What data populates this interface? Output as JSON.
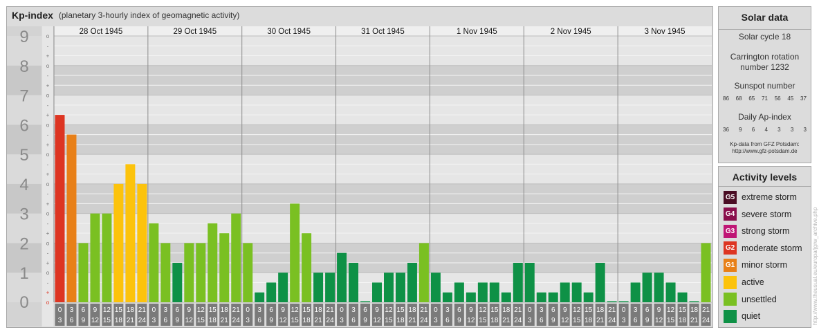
{
  "header": {
    "title": "Kp-index",
    "subtitle": "(planetary 3-hourly index of geomagnetic activity)"
  },
  "chart_data": {
    "type": "bar",
    "days": [
      "28 Oct 1945",
      "29 Oct 1945",
      "30 Oct 1945",
      "31 Oct 1945",
      "1 Nov 1945",
      "2 Nov 1945",
      "3 Nov 1945"
    ],
    "interval_start_hours": [
      "0",
      "3",
      "6",
      "9",
      "12",
      "15",
      "18",
      "21"
    ],
    "interval_end_hours": [
      "3",
      "6",
      "9",
      "12",
      "15",
      "18",
      "21",
      "24"
    ],
    "y_axis_labels": [
      "0",
      "1",
      "2",
      "3",
      "4",
      "5",
      "6",
      "7",
      "8",
      "9"
    ],
    "minor_tick_labels": [
      "o",
      "+",
      "-",
      "o",
      "+",
      "-",
      "o",
      "+",
      "-",
      "o",
      "+",
      "-",
      "o",
      "+",
      "-",
      "o",
      "+",
      "-",
      "o",
      "+",
      "-",
      "o",
      "+",
      "-",
      "o",
      "+",
      "-",
      "o"
    ],
    "ylim": [
      0,
      9
    ],
    "values": [
      6.333,
      5.667,
      2,
      3,
      3,
      4,
      4.667,
      4,
      2.667,
      2,
      1.333,
      2,
      2,
      2.667,
      2.333,
      3,
      2,
      0.333,
      0.667,
      1,
      3.333,
      2.333,
      1,
      1,
      1.667,
      1.333,
      0,
      0.667,
      1,
      1,
      1.333,
      2,
      1,
      0.333,
      0.667,
      0.333,
      0.667,
      0.667,
      0.333,
      1.333,
      1.333,
      0.333,
      0.333,
      0.667,
      0.667,
      0.333,
      1.333,
      0,
      0,
      0.667,
      1,
      1,
      0.667,
      0.333,
      0,
      2
    ]
  },
  "colors": {
    "quiet": "#0e9146",
    "unsettled": "#7ac022",
    "active": "#fcc30c",
    "minor_storm": "#e88018",
    "moderate_storm": "#dd3522",
    "strong_storm": "#bf1575",
    "severe_storm": "#8a0f4c",
    "extreme_storm": "#4a0d24"
  },
  "solar_data": {
    "title": "Solar data",
    "cycle": "Solar cycle 18",
    "carrington_line1": "Carrington rotation",
    "carrington_line2": "number 1232",
    "sunspot_label": "Sunspot number",
    "sunspot_values": [
      "86",
      "68",
      "65",
      "71",
      "56",
      "45",
      "37"
    ],
    "ap_label": "Daily Ap-index",
    "ap_values": [
      "36",
      "9",
      "6",
      "4",
      "3",
      "3",
      "3"
    ],
    "source_line1": "Kp-data from GFZ Potsdam:",
    "source_line2": "http://www.gfz-potsdam.de"
  },
  "activity_levels": {
    "title": "Activity levels",
    "items": [
      {
        "badge": "G5",
        "label": "extreme storm",
        "color": "#4a0d24"
      },
      {
        "badge": "G4",
        "label": "severe storm",
        "color": "#8a0f4c"
      },
      {
        "badge": "G3",
        "label": "strong storm",
        "color": "#bf1575"
      },
      {
        "badge": "G2",
        "label": "moderate storm",
        "color": "#dd3522"
      },
      {
        "badge": "G1",
        "label": "minor storm",
        "color": "#e88018"
      },
      {
        "badge": "",
        "label": "active",
        "color": "#fcc30c"
      },
      {
        "badge": "",
        "label": "unsettled",
        "color": "#7ac022"
      },
      {
        "badge": "",
        "label": "quiet",
        "color": "#0e9146"
      }
    ]
  },
  "watermark": "http://www.theusual.eu/europa/jgrw_archive.php"
}
